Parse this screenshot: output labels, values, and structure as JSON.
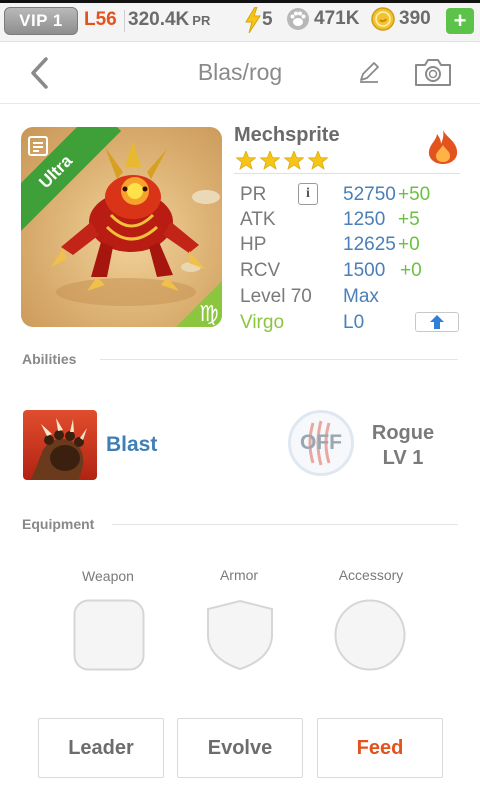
{
  "status_bar": {
    "vip": "VIP 1",
    "level": "L56",
    "pr_value": "320.4K",
    "pr_unit": "PR",
    "energy": "5",
    "paw_points": "471K",
    "coins": "390",
    "plus": "+"
  },
  "nav": {
    "title": "Blas/rog"
  },
  "pet": {
    "name": "Mechsprite",
    "rarity": "Ultra",
    "stars": 4,
    "element": "fire",
    "stats": [
      {
        "label": "PR",
        "value": "52750",
        "bonus": "+50"
      },
      {
        "label": "ATK",
        "value": "1250",
        "bonus": "+5"
      },
      {
        "label": "HP",
        "value": "12625",
        "bonus": "+0"
      },
      {
        "label": "RCV",
        "value": "1500",
        "bonus": "+0"
      }
    ],
    "level_label": "Level 70",
    "level_value": "Max",
    "zodiac_label": "Virgo",
    "zodiac_value": "L0"
  },
  "abilities": {
    "header": "Abilities",
    "ability_name": "Blast",
    "toggle": "OFF",
    "class_name": "Rogue",
    "class_level": "LV 1"
  },
  "equipment": {
    "header": "Equipment",
    "weapon": "Weapon",
    "armor": "Armor",
    "accessory": "Accessory"
  },
  "buttons": {
    "leader": "Leader",
    "evolve": "Evolve",
    "feed": "Feed"
  },
  "colors": {
    "accent_orange": "#e2531e",
    "stat_blue": "#4a7fb8",
    "bonus_green": "#6ac140",
    "ribbon_green": "#3f9f39",
    "star_yellow": "#f5c518"
  }
}
